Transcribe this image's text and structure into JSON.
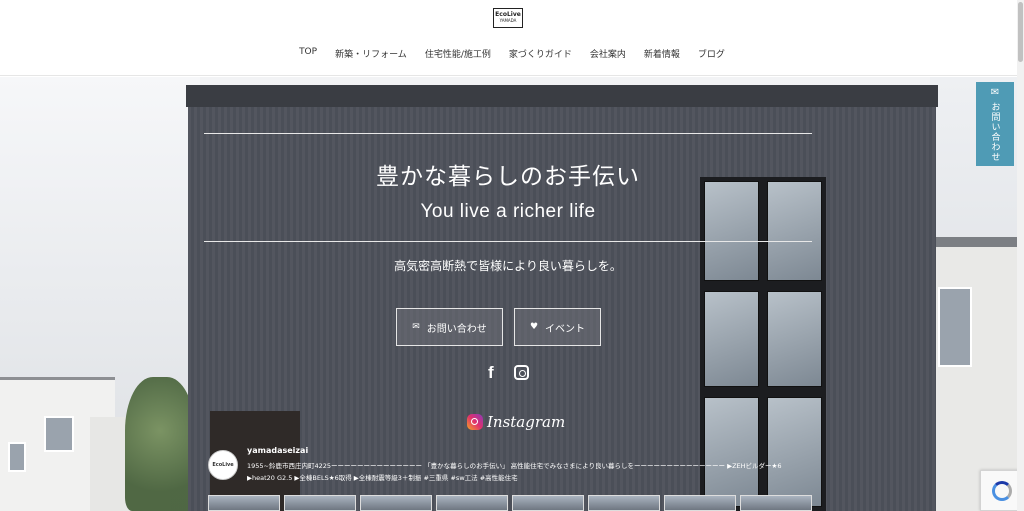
{
  "logo": {
    "name": "EcoLive",
    "sub": "YAMADA"
  },
  "nav": [
    {
      "label": "TOP"
    },
    {
      "label": "新築・リフォーム"
    },
    {
      "label": "住宅性能/施工例"
    },
    {
      "label": "家づくりガイド"
    },
    {
      "label": "会社案内"
    },
    {
      "label": "新着情報"
    },
    {
      "label": "ブログ"
    }
  ],
  "hero": {
    "title_jp": "豊かな暮らしのお手伝い",
    "title_en": "You live a richer life",
    "subtitle": "高気密高断熱で皆様により良い暮らしを。",
    "buttons": {
      "contact": {
        "label": "お問い合わせ",
        "icon": "envelope-icon"
      },
      "event": {
        "label": "イベント",
        "icon": "heart-icon"
      }
    },
    "social": {
      "facebook": "f"
    }
  },
  "instagram": {
    "heading": "Instagram",
    "username": "yamadaseizai",
    "avatar_text": "EcoLive",
    "bio_line1": "1955~鈴鹿市西庄内町4225ーーーーーーーーーーーーーー 「豊かな暮らしのお手伝い」 高性能住宅でみなさまにより良い暮らしをーーーーーーーーーーーーーー ▶ZEHビルダー★6",
    "bio_line2": "▶heat20 G2.5 ▶全棟BELS★6取得 ▶全棟耐震等級3＋制振 #三重県 #sw工法 #高性能住宅"
  },
  "contact_tab": {
    "label": "お問い合わせ",
    "icon": "envelope-icon"
  },
  "colors": {
    "accent": "#4f9bb5",
    "header_bg": "#ffffff",
    "nav_text": "#333333"
  }
}
